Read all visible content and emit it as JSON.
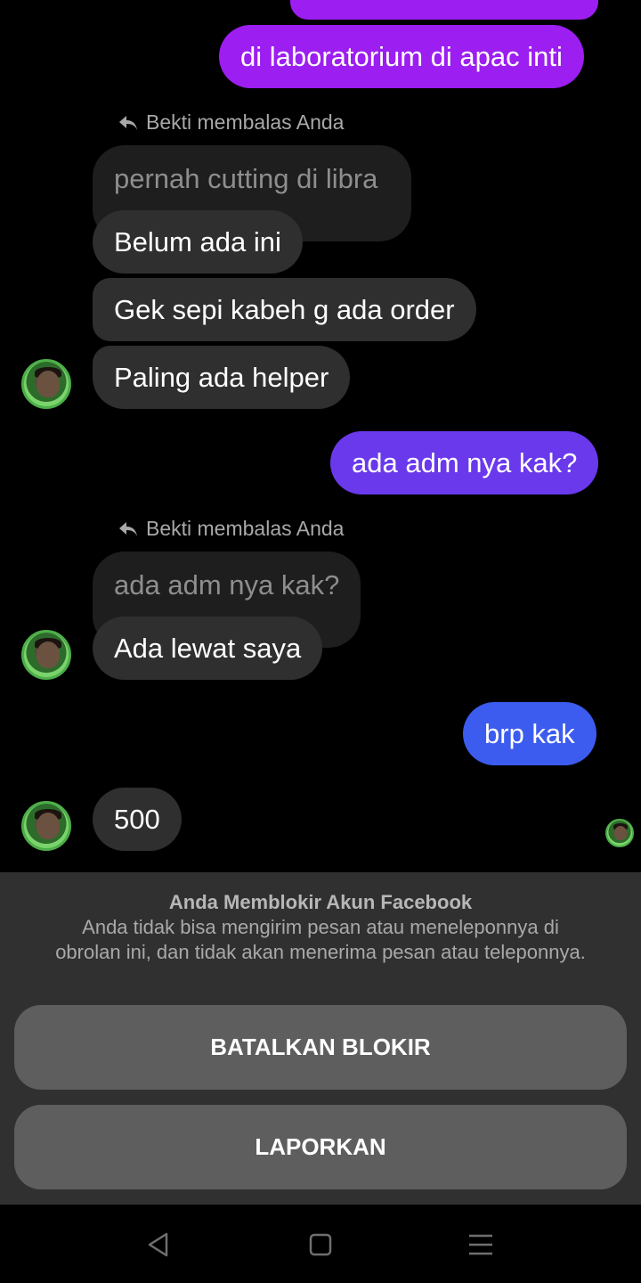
{
  "messages": {
    "top_outgoing": "di laboratorium di apac inti",
    "reply_note_1": "Bekti membalas Anda",
    "quoted_1": "pernah cutting di libra",
    "incoming_1": "Belum ada ini",
    "incoming_2": "Gek sepi kabeh g ada order",
    "incoming_3": "Paling ada helper",
    "outgoing_2": "ada adm nya kak?",
    "reply_note_2": "Bekti membalas Anda",
    "quoted_2": "ada adm nya kak?",
    "incoming_4": "Ada lewat saya",
    "outgoing_3": "brp kak",
    "incoming_5": "500"
  },
  "block_panel": {
    "title": "Anda Memblokir Akun Facebook",
    "description": "Anda tidak bisa mengirim pesan atau meneleponnya di obrolan ini, dan tidak akan menerima pesan atau teleponnya.",
    "unblock_label": "BATALKAN BLOKIR",
    "report_label": "LAPORKAN"
  },
  "nav": {
    "back": "back-icon",
    "home": "home-icon",
    "menu": "menu-icon"
  },
  "colors": {
    "outgoing_purple": "#9c1ef0",
    "outgoing_violet": "#6a39ec",
    "outgoing_blue": "#3c5cef",
    "incoming": "#2f2f2f",
    "quoted": "#1e1e1e",
    "panel": "#303030",
    "button": "#5e5e5e"
  }
}
